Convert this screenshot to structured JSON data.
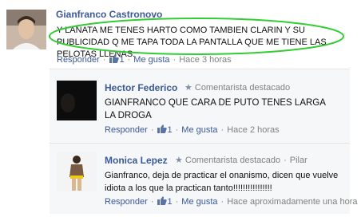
{
  "comments": [
    {
      "author": "Gianfranco Castronovo",
      "text": "Y LANATA ME TENES HARTO COMO TAMBIEN CLARIN Y SU PUBLICIDAD Q ME TAPA TODA LA PANTALLA QUE ME TIENE LAS PELOTAS LLENAS.",
      "reply_label": "Responder",
      "like_count": "1",
      "like_label": "Me gusta",
      "time": "Hace 3 horas"
    },
    {
      "author": "Hector Federico",
      "badge": "Comentarista destacado",
      "text": "GIANFRANCO QUE CARA DE PUTO TENES LARGA LA DROGA",
      "reply_label": "Responder",
      "like_count": "1",
      "like_label": "Me gusta",
      "time": "Hace 2 horas"
    },
    {
      "author": "Monica Lepez",
      "badge": "Comentarista destacado",
      "location": "Pilar",
      "text": "Gianfranco, deja de practicar el onanismo, dicen que vuelve idiota a los que la practican tanto!!!!!!!!!!!!!!!!",
      "reply_label": "Responder",
      "like_count": "1",
      "like_label": "Me gusta",
      "time": "Hace aproximadamente una hora"
    }
  ],
  "icons": {
    "like": "thumbs-up-icon",
    "badge": "star-icon"
  },
  "colors": {
    "link": "#3b5998",
    "highlight_oval": "#33cc33",
    "muted": "#808080"
  }
}
